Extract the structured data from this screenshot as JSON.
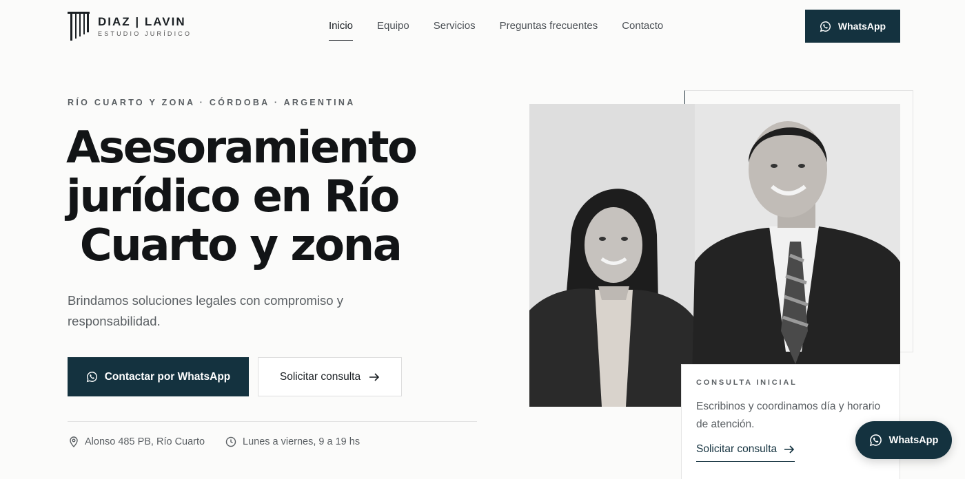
{
  "brand": {
    "name": "DIAZ | LAVIN",
    "tagline": "ESTUDIO JURÍDICO"
  },
  "nav": {
    "items": [
      {
        "label": "Inicio",
        "active": true
      },
      {
        "label": "Equipo"
      },
      {
        "label": "Servicios"
      },
      {
        "label": "Preguntas frecuentes"
      },
      {
        "label": "Contacto"
      }
    ]
  },
  "header": {
    "whatsapp_label": "WhatsApp"
  },
  "hero": {
    "eyebrow": "RÍO CUARTO Y ZONA · CÓRDOBA · ARGENTINA",
    "headline": [
      "Asesoramiento",
      "jurídico en Río",
      " Cuarto y zona"
    ],
    "subtitle": "Brindamos soluciones legales con compromiso y responsabilidad.",
    "primary_cta": "Contactar por WhatsApp",
    "secondary_cta": "Solicitar consulta",
    "address": "Alonso 485 PB, Río Cuarto",
    "hours": "Lunes a viernes, 9 a 19 hs"
  },
  "card": {
    "eyebrow": "CONSULTA INICIAL",
    "text": "Escribinos y coordinamos día y horario de atención.",
    "link": "Solicitar consulta"
  },
  "floating": {
    "whatsapp_label": "WhatsApp"
  },
  "colors": {
    "primary": "#14323f",
    "background": "#fbfbfa",
    "text": "#121416",
    "muted": "#5a5f63"
  }
}
